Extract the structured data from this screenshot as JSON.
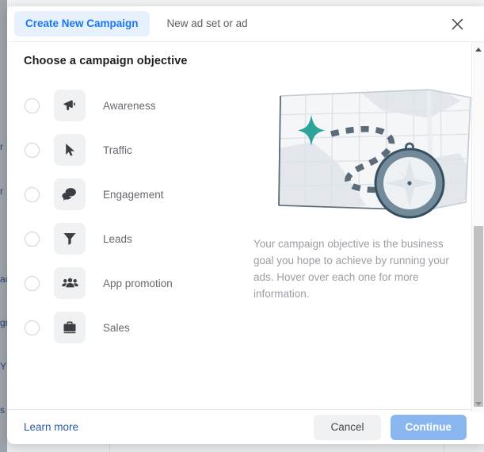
{
  "dialog": {
    "tabs": [
      {
        "label": "Create New Campaign",
        "active": true
      },
      {
        "label": "New ad set or ad",
        "active": false
      }
    ],
    "close_icon": "close-icon",
    "section_title": "Choose a campaign objective",
    "objectives": [
      {
        "label": "Awareness",
        "icon": "megaphone-icon",
        "selected": false
      },
      {
        "label": "Traffic",
        "icon": "cursor-icon",
        "selected": false
      },
      {
        "label": "Engagement",
        "icon": "chat-bubbles-icon",
        "selected": false
      },
      {
        "label": "Leads",
        "icon": "funnel-icon",
        "selected": false
      },
      {
        "label": "App promotion",
        "icon": "people-icon",
        "selected": false
      },
      {
        "label": "Sales",
        "icon": "briefcase-icon",
        "selected": false
      }
    ],
    "info": {
      "illustration": "map-with-compass-illustration",
      "description": "Your campaign objective is the business goal you hope to achieve by running your ads. Hover over each one for more information."
    },
    "footer": {
      "learn_more_label": "Learn more",
      "cancel_label": "Cancel",
      "continue_label": "Continue",
      "continue_disabled": true
    },
    "scrollbar": {
      "up_arrow_icon": "chevron-up-icon",
      "down_arrow_icon": "chevron-down-icon"
    }
  },
  "colors": {
    "accent_blue": "#1877f2",
    "tab_active_bg": "#e7f0fd",
    "continue_disabled_bg": "#8ab6f0",
    "cancel_bg": "#f0f1f3",
    "icon_tile_bg": "#f0f1f3",
    "label_gray": "#65696f",
    "description_gray": "#9a9ea4",
    "link_blue": "#2a58a8",
    "map_star_teal": "#2ea39b",
    "compass_dark": "#37505f"
  },
  "background": {
    "left_fragments": [
      "r",
      "r",
      "ac",
      "gr",
      "Y",
      "s"
    ]
  }
}
